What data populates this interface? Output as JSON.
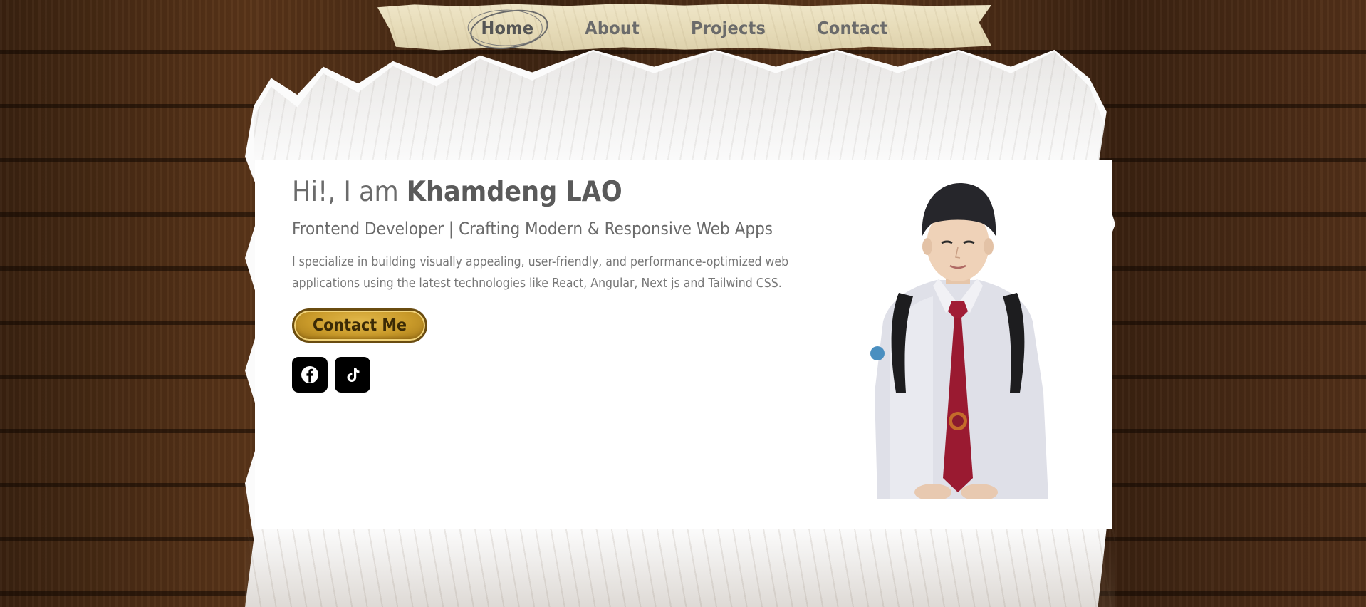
{
  "nav": {
    "items": [
      {
        "label": "Home",
        "active": true
      },
      {
        "label": "About",
        "active": false
      },
      {
        "label": "Projects",
        "active": false
      },
      {
        "label": "Contact",
        "active": false
      }
    ]
  },
  "hero": {
    "greeting": "Hi!, I am",
    "name": "Khamdeng LAO",
    "subtitle": "Frontend Developer | Crafting Modern & Responsive Web Apps",
    "description": "I specialize in building visually appealing, user-friendly, and performance-optimized web applications using the latest technologies like React, Angular, Next js and Tailwind CSS.",
    "cta_label": "Contact Me"
  },
  "socials": [
    {
      "icon": "facebook-icon"
    },
    {
      "icon": "tiktok-icon"
    }
  ],
  "colors": {
    "wood": "#4a2c15",
    "paint": "#fbfbfb",
    "button_gold": "#c99a2a",
    "button_border": "#6a4c10",
    "text_gray": "#6b6b6b"
  }
}
